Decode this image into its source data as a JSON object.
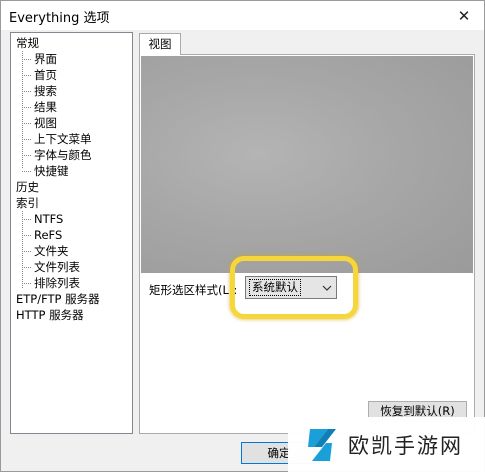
{
  "window": {
    "title": "Everything 选项",
    "close_glyph": "✕"
  },
  "tree": {
    "items": [
      {
        "label": "常规"
      },
      {
        "label": "界面"
      },
      {
        "label": "首页"
      },
      {
        "label": "搜索"
      },
      {
        "label": "结果"
      },
      {
        "label": "视图"
      },
      {
        "label": "上下文菜单"
      },
      {
        "label": "字体与颜色"
      },
      {
        "label": "快捷键"
      },
      {
        "label": "历史"
      },
      {
        "label": "索引"
      },
      {
        "label": "NTFS"
      },
      {
        "label": "ReFS"
      },
      {
        "label": "文件夹"
      },
      {
        "label": "文件列表"
      },
      {
        "label": "排除列表"
      },
      {
        "label": "ETP/FTP 服务器"
      },
      {
        "label": "HTTP 服务器"
      }
    ]
  },
  "tab": {
    "label": "视图"
  },
  "view": {
    "rect_style_label": "矩形选区样式(L):",
    "rect_style_value": "系统默认",
    "restore_label": "恢复到默认(R)"
  },
  "footer": {
    "ok_label": "确定"
  },
  "watermark": {
    "text": "欧凯手游网",
    "logo_color": "#1a9fd8"
  }
}
